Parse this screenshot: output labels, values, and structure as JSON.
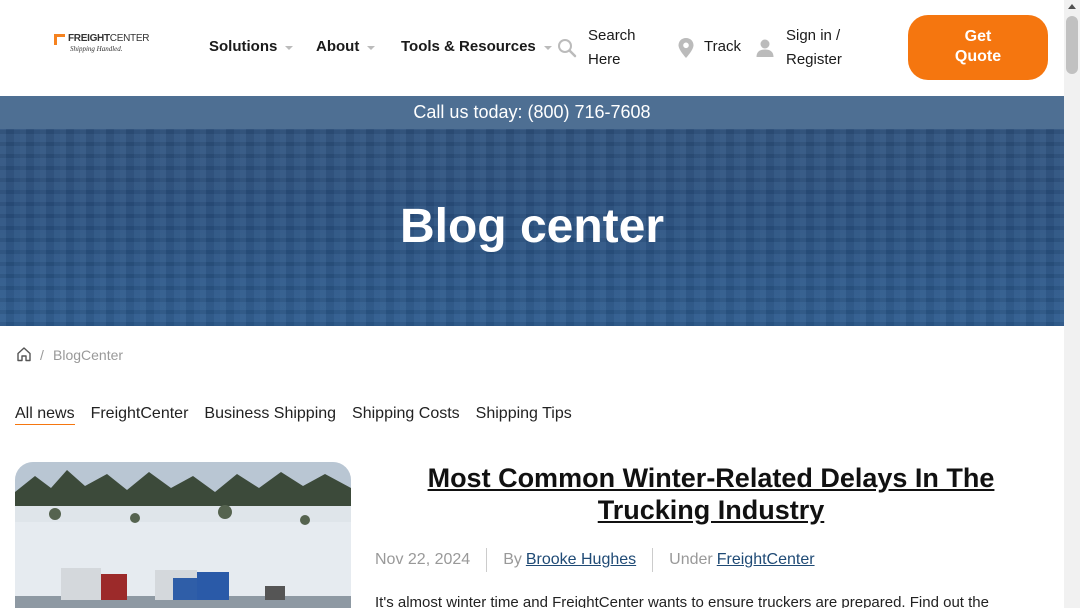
{
  "logo": {
    "brand_bold": "FREIGHT",
    "brand_light": "CENTER",
    "tagline": "Shipping Handled."
  },
  "nav": {
    "solutions": "Solutions",
    "about": "About",
    "tools": "Tools & Resources",
    "search_line1": "Search",
    "search_line2": "Here",
    "track": "Track",
    "sign_line1": "Sign in /",
    "sign_line2": "Register",
    "quote_line1": "Get",
    "quote_line2": "Quote"
  },
  "callbar": {
    "text": "Call us today: (800) 716-7608"
  },
  "hero": {
    "title": "Blog center"
  },
  "breadcrumb": {
    "separator": "/",
    "current": "BlogCenter"
  },
  "tabs": [
    "All news",
    "FreightCenter",
    "Business Shipping",
    "Shipping Costs",
    "Shipping Tips"
  ],
  "article": {
    "title": "Most Common Winter-Related Delays In The Trucking Industry",
    "date": "Nov 22, 2024",
    "by_label": "By",
    "author": "Brooke Hughes",
    "under_label": "Under",
    "category": "FreightCenter",
    "excerpt": "It's almost winter time and FreightCenter wants to ensure truckers are prepared. Find out the"
  },
  "colors": {
    "accent": "#f5760f",
    "callbar": "#4e6f93",
    "hero": "#2d5483",
    "link": "#1f4a75"
  }
}
